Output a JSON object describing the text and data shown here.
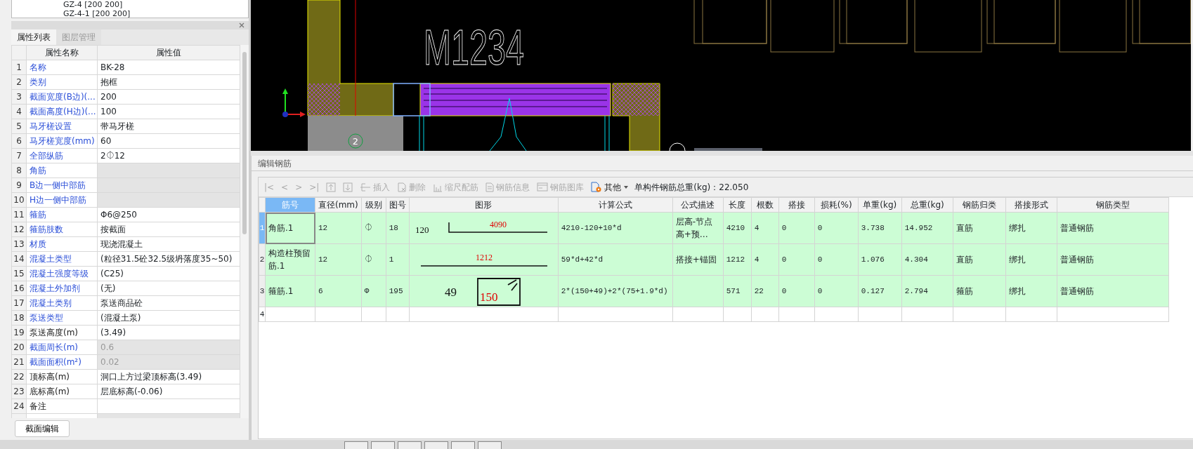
{
  "tree_items": [
    {
      "label": "GZ-4 [200 200]"
    },
    {
      "label": "GZ-4-1 [200 200]"
    }
  ],
  "property_panel": {
    "tabs": [
      {
        "label": "属性列表",
        "selected": true
      },
      {
        "label": "图层管理",
        "selected": false
      }
    ],
    "columns": [
      "属性名称",
      "属性值"
    ],
    "rows": [
      {
        "index": "1",
        "name": "名称",
        "value": "BK-28",
        "public": true,
        "disabled": false
      },
      {
        "index": "2",
        "name": "类别",
        "value": "抱框",
        "public": true,
        "disabled": false
      },
      {
        "index": "3",
        "name": "截面宽度(B边)(...",
        "value": "200",
        "public": true,
        "disabled": false
      },
      {
        "index": "4",
        "name": "截面高度(H边)(...",
        "value": "100",
        "public": true,
        "disabled": false
      },
      {
        "index": "5",
        "name": "马牙槎设置",
        "value": "带马牙槎",
        "public": true,
        "disabled": false
      },
      {
        "index": "6",
        "name": "马牙槎宽度(mm)",
        "value": "60",
        "public": true,
        "disabled": false
      },
      {
        "index": "7",
        "name": "全部纵筋",
        "value": "2⏀12",
        "public": true,
        "disabled": false
      },
      {
        "index": "8",
        "name": "角筋",
        "public": true,
        "disabled": true
      },
      {
        "index": "9",
        "name": "B边一侧中部筋",
        "public": true,
        "disabled": true
      },
      {
        "index": "10",
        "name": "H边一侧中部筋",
        "public": true,
        "disabled": true
      },
      {
        "index": "11",
        "name": "箍筋",
        "value": "Φ6@250",
        "public": true,
        "disabled": false
      },
      {
        "index": "12",
        "name": "箍筋肢数",
        "value": "按截面",
        "public": true,
        "disabled": false
      },
      {
        "index": "13",
        "name": "材质",
        "value": "现浇混凝土",
        "public": true,
        "disabled": false
      },
      {
        "index": "14",
        "name": "混凝土类型",
        "value": "(粒径31.5砼32.5级坍落度35~50)",
        "public": true,
        "disabled": false
      },
      {
        "index": "15",
        "name": "混凝土强度等级",
        "value": "(C25)",
        "public": true,
        "disabled": false
      },
      {
        "index": "16",
        "name": "混凝土外加剂",
        "value": "(无)",
        "public": true,
        "disabled": false
      },
      {
        "index": "17",
        "name": "混凝土类别",
        "value": "泵送商品砼",
        "public": true,
        "disabled": false
      },
      {
        "index": "18",
        "name": "泵送类型",
        "value": "(混凝土泵)",
        "public": true,
        "disabled": false
      },
      {
        "index": "19",
        "name": "泵送高度(m)",
        "value": "(3.49)",
        "public": false,
        "disabled": false
      },
      {
        "index": "20",
        "name": "截面周长(m)",
        "value": "0.6",
        "public": true,
        "disabled": true
      },
      {
        "index": "21",
        "name": "截面面积(m²)",
        "value": "0.02",
        "public": true,
        "disabled": true
      },
      {
        "index": "22",
        "name": "顶标高(m)",
        "value": "洞口上方过梁顶标高(3.49)",
        "public": false,
        "disabled": false
      },
      {
        "index": "23",
        "name": "底标高(m)",
        "value": "层底标高(-0.06)",
        "public": false,
        "disabled": false
      },
      {
        "index": "24",
        "name": "备注",
        "public": false,
        "disabled": false
      }
    ],
    "button": "截面编辑"
  },
  "cad": {
    "door_label": "M1234",
    "axis_label": "2"
  },
  "rebar_editor": {
    "title": "编辑钢筋",
    "toolbar": [
      {
        "kind": "nav",
        "label": "|<",
        "disabled": true
      },
      {
        "kind": "nav",
        "label": "<",
        "disabled": true
      },
      {
        "kind": "nav",
        "label": ">",
        "disabled": true
      },
      {
        "kind": "nav",
        "label": ">|",
        "disabled": true
      },
      {
        "kind": "icon",
        "disabled": true
      },
      {
        "kind": "icon",
        "disabled": true
      },
      {
        "kind": "icon-text",
        "label": "插入",
        "disabled": true
      },
      {
        "kind": "icon-text",
        "label": "删除",
        "disabled": true
      },
      {
        "kind": "icon-text",
        "label": "缩尺配筋",
        "disabled": true
      },
      {
        "kind": "icon-text",
        "label": "钢筋信息",
        "disabled": true
      },
      {
        "kind": "icon-text",
        "label": "钢筋图库",
        "disabled": true
      },
      {
        "kind": "menu",
        "label": "其他",
        "disabled": false
      }
    ],
    "total_weight": "单构件钢筋总重(kg)：22.050",
    "columns": [
      {
        "label": "筋号",
        "selected": true
      },
      {
        "label": "直径(mm)",
        "selected": false
      },
      {
        "label": "级别",
        "selected": false
      },
      {
        "label": "图号",
        "selected": false
      },
      {
        "label": "图形",
        "selected": false
      },
      {
        "label": "计算公式",
        "selected": false
      },
      {
        "label": "公式描述",
        "selected": false
      },
      {
        "label": "长度",
        "selected": false
      },
      {
        "label": "根数",
        "selected": false
      },
      {
        "label": "搭接",
        "selected": false
      },
      {
        "label": "损耗(%)",
        "selected": false
      },
      {
        "label": "单重(kg)",
        "selected": false
      },
      {
        "label": "总重(kg)",
        "selected": false
      },
      {
        "label": "钢筋归类",
        "selected": false
      },
      {
        "label": "搭接形式",
        "selected": false
      },
      {
        "label": "钢筋类型",
        "selected": false
      }
    ],
    "rows": [
      {
        "index": "1",
        "selected": true,
        "bar_no": "角筋.1",
        "diameter": "12",
        "grade": "⏀",
        "shape_no": "18",
        "shape": {
          "kind": "bent",
          "side": "120",
          "length": "4090"
        },
        "formula": "4210-120+10*d",
        "formula_desc": "层高-节点高+预…",
        "length": "4210",
        "count": "4",
        "lap": "0",
        "loss": "0",
        "unit_weight": "3.738",
        "total_weight": "14.952",
        "category": "直筋",
        "lap_type": "绑扎",
        "bar_type": "普通钢筋"
      },
      {
        "index": "2",
        "selected": false,
        "bar_no": "构造柱预留筋.1",
        "diameter": "12",
        "grade": "⏀",
        "shape_no": "1",
        "shape": {
          "kind": "straight",
          "length": "1212"
        },
        "formula": "59*d+42*d",
        "formula_desc": "搭接+锚固",
        "length": "1212",
        "count": "4",
        "lap": "0",
        "loss": "0",
        "unit_weight": "1.076",
        "total_weight": "4.304",
        "category": "直筋",
        "lap_type": "绑扎",
        "bar_type": "普通钢筋"
      },
      {
        "index": "3",
        "selected": false,
        "bar_no": "箍筋.1",
        "diameter": "6",
        "grade": "Φ",
        "shape_no": "195",
        "shape": {
          "kind": "stirrup",
          "side": "49",
          "length": "150"
        },
        "formula": "2*(150+49)+2*(75+1.9*d)",
        "length": "571",
        "count": "22",
        "lap": "0",
        "loss": "0",
        "unit_weight": "0.127",
        "total_weight": "2.794",
        "category": "箍筋",
        "lap_type": "绑扎",
        "bar_type": "普通钢筋"
      },
      {
        "index": "4",
        "selected": false
      }
    ]
  }
}
